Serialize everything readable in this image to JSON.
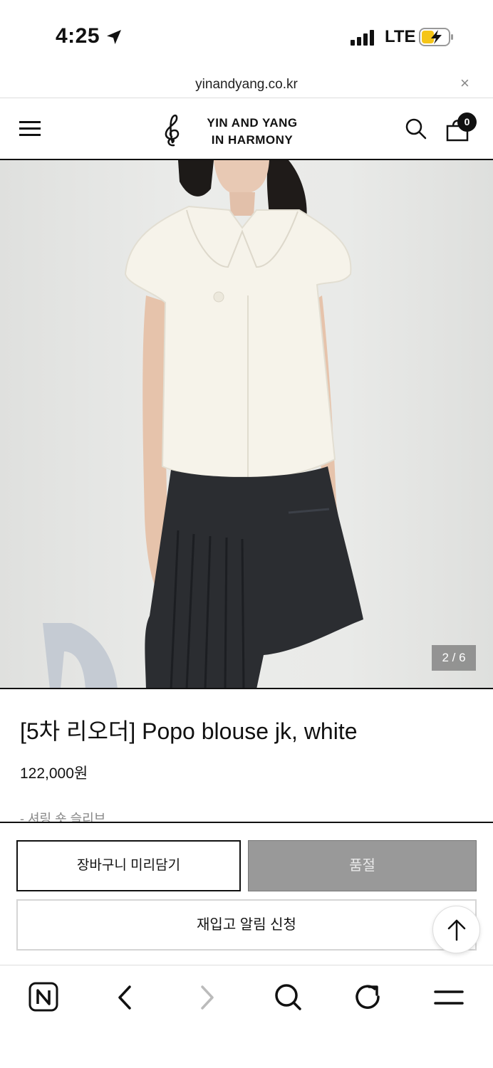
{
  "status_bar": {
    "time": "4:25",
    "network": "LTE",
    "icons": [
      "location-arrow-icon",
      "signal-icon",
      "battery-charging-icon"
    ]
  },
  "url_bar": {
    "domain": "yinandyang.co.kr",
    "close_label": "×"
  },
  "header": {
    "logo_line1": "YIN AND YANG",
    "logo_line2": "IN HARMONY",
    "cart_count": "0",
    "icons": [
      "menu-icon",
      "treble-clef-logo",
      "search-icon",
      "shopping-bag-icon"
    ]
  },
  "product": {
    "image_counter": "2 / 6",
    "title": "[5차 리오더] Popo blouse jk, white",
    "price": "122,000원",
    "description_first_line": "- 셔링 숏 슬리브"
  },
  "actions": {
    "cart_label": "장바구니 미리담기",
    "soldout_label": "품절",
    "restock_label": "재입고 알림 신청"
  },
  "browser_toolbar": {
    "icons": [
      "naver-home-icon",
      "back-icon",
      "forward-icon",
      "search-icon",
      "reload-icon",
      "menu-icon"
    ]
  },
  "colors": {
    "text": "#111111",
    "soldout_bg": "#999999",
    "muted": "#888888",
    "battery_charge": "#f5c518"
  }
}
